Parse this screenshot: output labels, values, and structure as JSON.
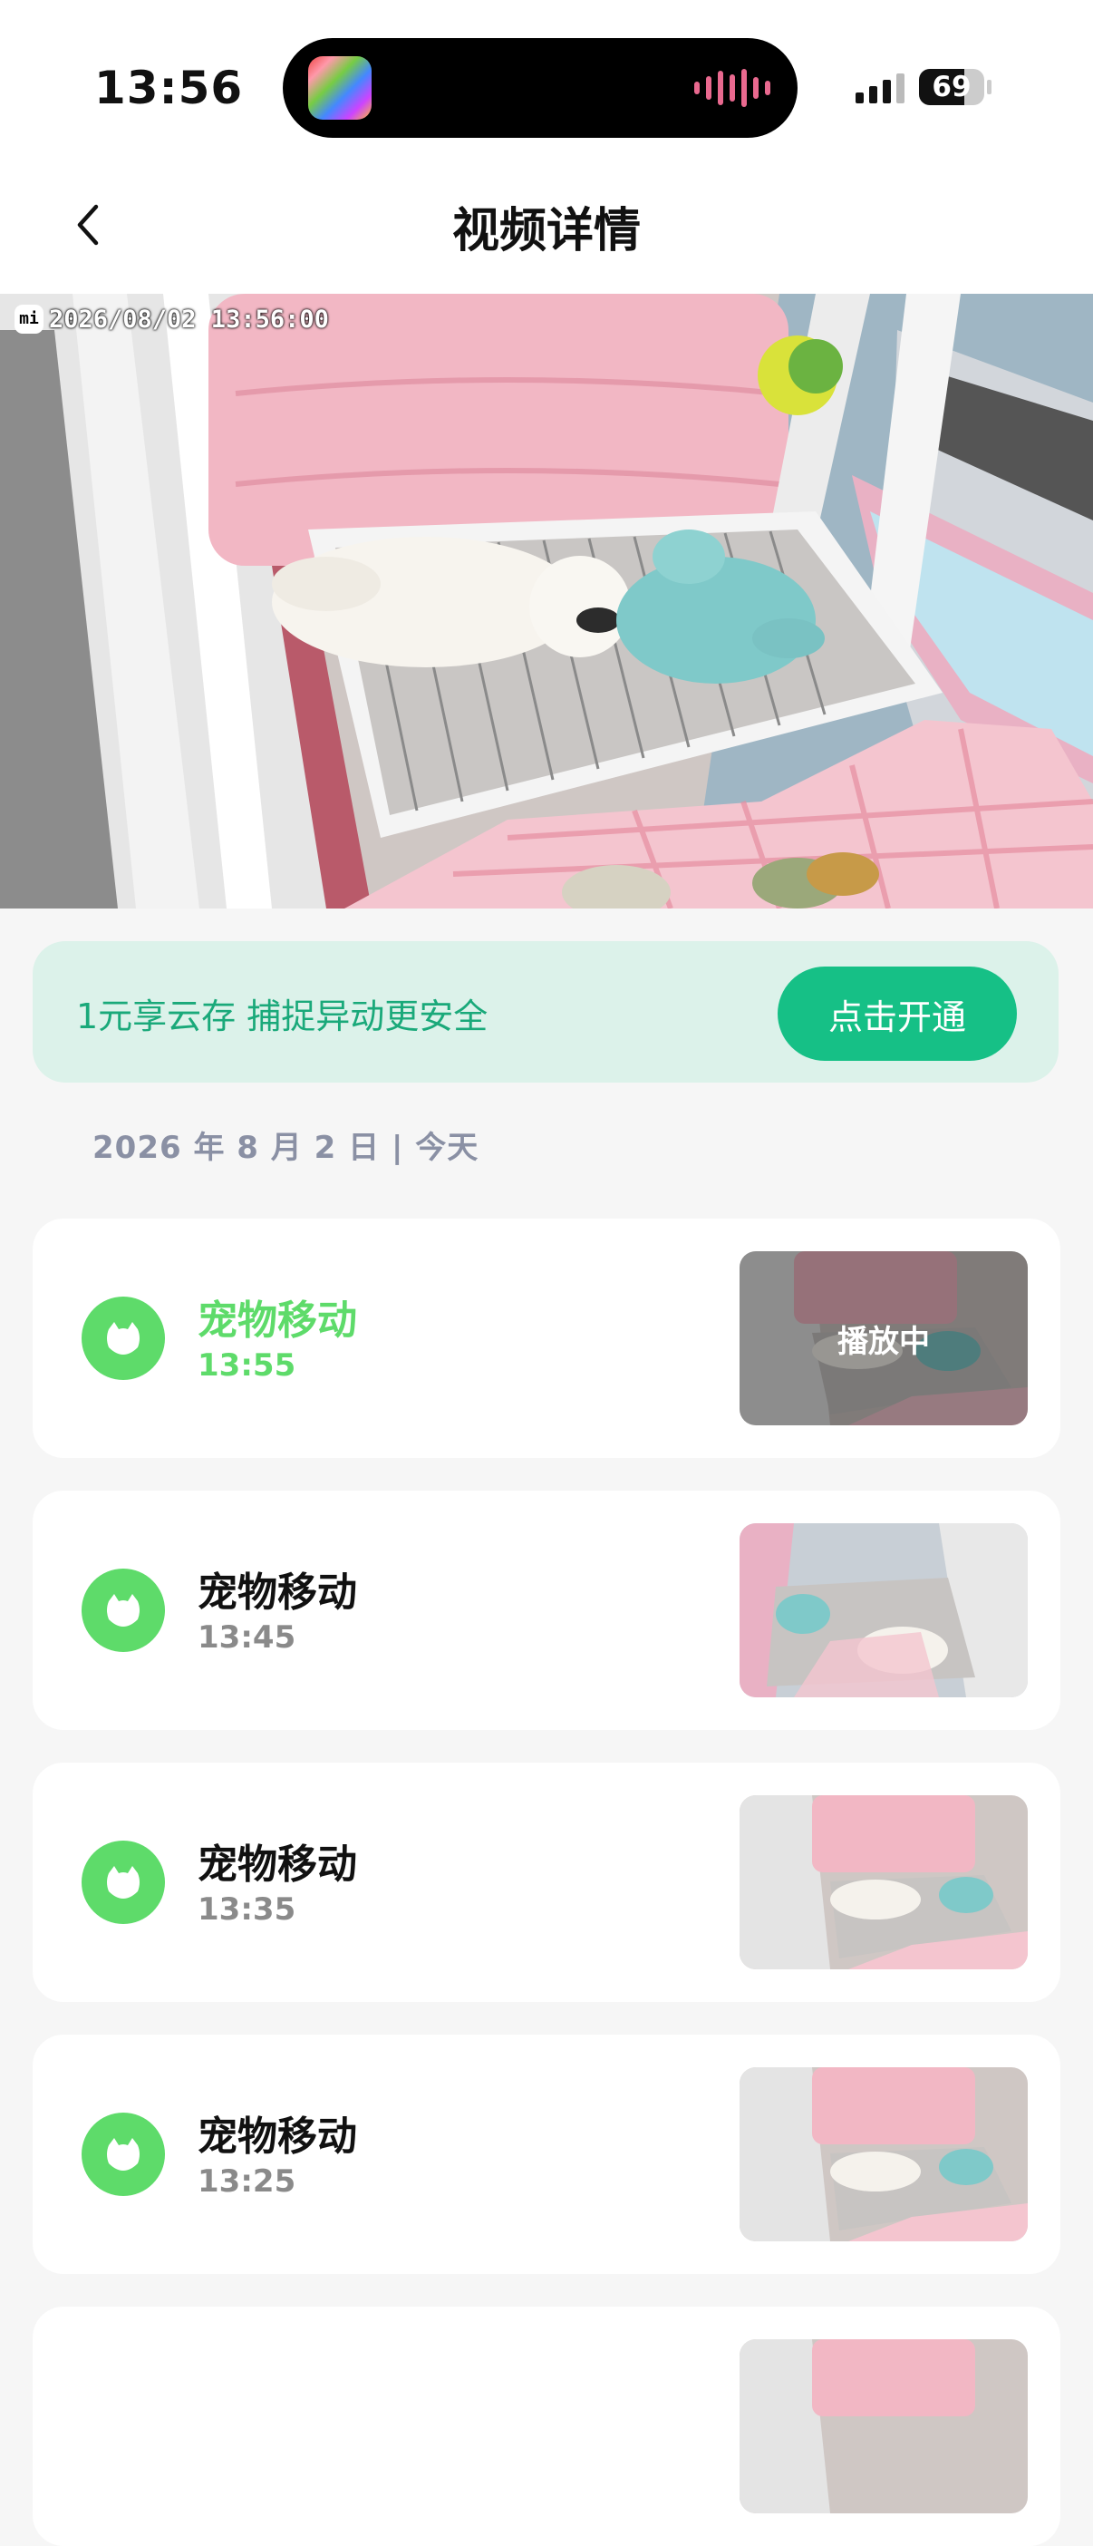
{
  "status_bar": {
    "time": "13:56",
    "battery": "69",
    "battery_level": 0.69,
    "signal_bars_active": 3,
    "signal_bars_total": 4
  },
  "header": {
    "title": "视频详情",
    "back_icon": "chevron-left-icon"
  },
  "video": {
    "timestamp": "2026/08/02  13:56:00",
    "camera_logo": "mi"
  },
  "promo": {
    "text": "1元享云存 捕捉异动更安全",
    "button": "点击开通",
    "colors": {
      "background": "#dcf2ea",
      "text": "#1aa97a",
      "button": "#16c086"
    }
  },
  "date_header": "2026 年 8 月 2 日 | 今天",
  "events": [
    {
      "title": "宠物移动",
      "time": "13:55",
      "active": true,
      "overlay": "播放中"
    },
    {
      "title": "宠物移动",
      "time": "13:45",
      "active": false
    },
    {
      "title": "宠物移动",
      "time": "13:35",
      "active": false
    },
    {
      "title": "宠物移动",
      "time": "13:25",
      "active": false
    },
    {
      "title": "",
      "time": "",
      "active": false
    }
  ],
  "colors": {
    "accent": "#5edb6a",
    "muted": "#8a90a4"
  }
}
